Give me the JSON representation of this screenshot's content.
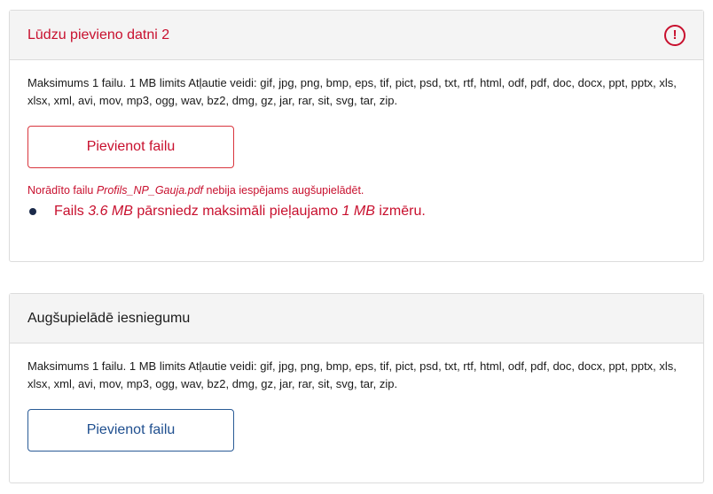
{
  "upload1": {
    "title": "Lūdzu pievieno datni 2",
    "hint": "Maksimums 1 failu. 1 MB limits Atļautie veidi: gif, jpg, png, bmp, eps, tif, pict, psd, txt, rtf, html, odf, pdf, doc, docx, ppt, pptx, xls, xlsx, xml, avi, mov, mp3, ogg, wav, bz2, dmg, gz, jar, rar, sit, svg, tar, zip.",
    "button": "Pievienot failu",
    "error": {
      "prefix": "Norādīto failu ",
      "filename": "Profils_NP_Gauja.pdf",
      "suffix": " nebija iespējams augšupielādēt."
    },
    "error_item": {
      "p1": "Fails ",
      "size": "3.6 MB",
      "p2": " pārsniedz maksimāli pieļaujamo ",
      "limit": "1 MB",
      "p3": " izmēru."
    },
    "status_color": "#c8102e"
  },
  "upload2": {
    "title": "Augšupielādē iesniegumu",
    "hint": "Maksimums 1 failu. 1 MB limits Atļautie veidi: gif, jpg, png, bmp, eps, tif, pict, psd, txt, rtf, html, odf, pdf, doc, docx, ppt, pptx, xls, xlsx, xml, avi, mov, mp3, ogg, wav, bz2, dmg, gz, jar, rar, sit, svg, tar, zip.",
    "button": "Pievienot failu"
  },
  "icons": {
    "alert": "exclamation-circle-icon",
    "bullet": "bullet-dot-icon"
  }
}
